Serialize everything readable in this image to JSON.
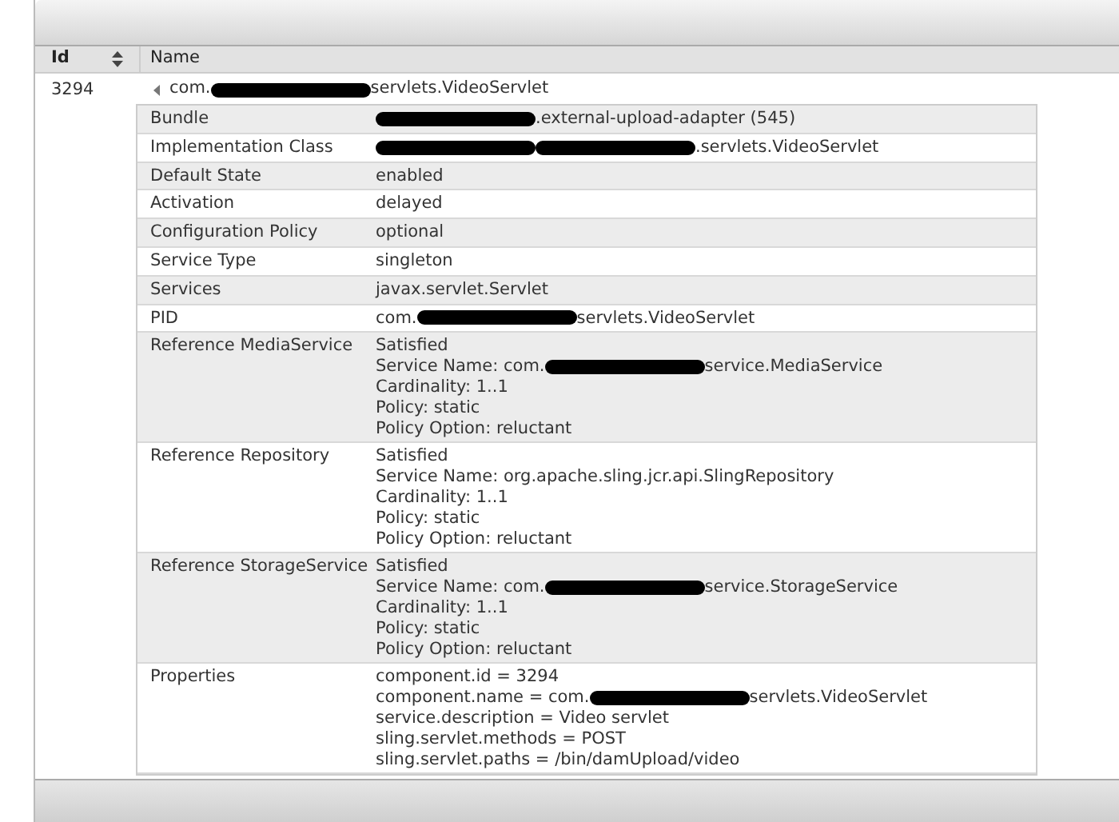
{
  "table": {
    "columns": [
      {
        "label": "Id",
        "sortable": true
      },
      {
        "label": "Name",
        "sortable": false
      }
    ],
    "rows": [
      {
        "id": "3294",
        "expanded": true,
        "name": [
          {
            "kind": "text",
            "text": "com."
          },
          {
            "kind": "redacted"
          },
          {
            "kind": "text",
            "text": "servlets.VideoServlet"
          }
        ],
        "details": [
          {
            "label": "Bundle",
            "lines": [
              [
                {
                  "kind": "redacted"
                },
                {
                  "kind": "text",
                  "text": ".external-upload-adapter (545)"
                }
              ]
            ]
          },
          {
            "label": "Implementation Class",
            "lines": [
              [
                {
                  "kind": "redacted"
                },
                {
                  "kind": "redacted"
                },
                {
                  "kind": "text",
                  "text": ".servlets.VideoServlet"
                }
              ]
            ]
          },
          {
            "label": "Default State",
            "lines": [
              [
                {
                  "kind": "text",
                  "text": "enabled"
                }
              ]
            ]
          },
          {
            "label": "Activation",
            "lines": [
              [
                {
                  "kind": "text",
                  "text": "delayed"
                }
              ]
            ]
          },
          {
            "label": "Configuration Policy",
            "lines": [
              [
                {
                  "kind": "text",
                  "text": "optional"
                }
              ]
            ]
          },
          {
            "label": "Service Type",
            "lines": [
              [
                {
                  "kind": "text",
                  "text": "singleton"
                }
              ]
            ]
          },
          {
            "label": "Services",
            "lines": [
              [
                {
                  "kind": "text",
                  "text": "javax.servlet.Servlet"
                }
              ]
            ]
          },
          {
            "label": "PID",
            "lines": [
              [
                {
                  "kind": "text",
                  "text": "com."
                },
                {
                  "kind": "redacted"
                },
                {
                  "kind": "text",
                  "text": "servlets.VideoServlet"
                }
              ]
            ]
          },
          {
            "label": "Reference MediaService",
            "lines": [
              [
                {
                  "kind": "text",
                  "text": "Satisfied"
                }
              ],
              [
                {
                  "kind": "text",
                  "text": "Service Name: com."
                },
                {
                  "kind": "redacted"
                },
                {
                  "kind": "text",
                  "text": "service.MediaService"
                }
              ],
              [
                {
                  "kind": "text",
                  "text": "Cardinality: 1..1"
                }
              ],
              [
                {
                  "kind": "text",
                  "text": "Policy: static"
                }
              ],
              [
                {
                  "kind": "text",
                  "text": "Policy Option: reluctant"
                }
              ]
            ]
          },
          {
            "label": "Reference Repository",
            "lines": [
              [
                {
                  "kind": "text",
                  "text": "Satisfied"
                }
              ],
              [
                {
                  "kind": "text",
                  "text": "Service Name: org.apache.sling.jcr.api.SlingRepository"
                }
              ],
              [
                {
                  "kind": "text",
                  "text": "Cardinality: 1..1"
                }
              ],
              [
                {
                  "kind": "text",
                  "text": "Policy: static"
                }
              ],
              [
                {
                  "kind": "text",
                  "text": "Policy Option: reluctant"
                }
              ]
            ]
          },
          {
            "label": "Reference StorageService",
            "lines": [
              [
                {
                  "kind": "text",
                  "text": "Satisfied"
                }
              ],
              [
                {
                  "kind": "text",
                  "text": "Service Name: com."
                },
                {
                  "kind": "redacted"
                },
                {
                  "kind": "text",
                  "text": "service.StorageService"
                }
              ],
              [
                {
                  "kind": "text",
                  "text": "Cardinality: 1..1"
                }
              ],
              [
                {
                  "kind": "text",
                  "text": "Policy: static"
                }
              ],
              [
                {
                  "kind": "text",
                  "text": "Policy Option: reluctant"
                }
              ]
            ]
          },
          {
            "label": "Properties",
            "lines": [
              [
                {
                  "kind": "text",
                  "text": "component.id = 3294"
                }
              ],
              [
                {
                  "kind": "text",
                  "text": "component.name = com."
                },
                {
                  "kind": "redacted"
                },
                {
                  "kind": "text",
                  "text": "servlets.VideoServlet"
                }
              ],
              [
                {
                  "kind": "text",
                  "text": "service.description = Video servlet"
                }
              ],
              [
                {
                  "kind": "text",
                  "text": "sling.servlet.methods = POST"
                }
              ],
              [
                {
                  "kind": "text",
                  "text": "sling.servlet.paths = /bin/damUpload/video"
                }
              ]
            ]
          }
        ]
      }
    ]
  }
}
